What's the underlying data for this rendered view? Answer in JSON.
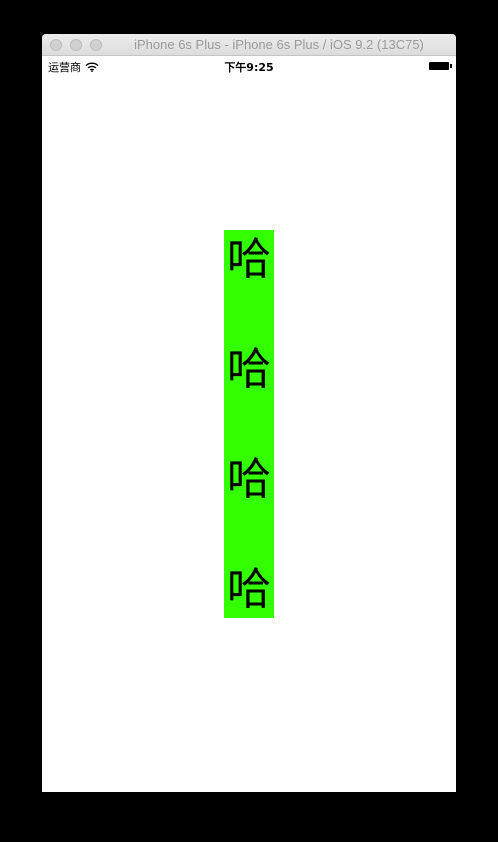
{
  "window": {
    "title": "iPhone 6s Plus - iPhone 6s Plus / iOS 9.2 (13C75)"
  },
  "status_bar": {
    "carrier": "运营商",
    "time": "下午9:25"
  },
  "label": {
    "characters": [
      "哈",
      "哈",
      "哈",
      "哈"
    ],
    "background_color": "#33ff00"
  }
}
